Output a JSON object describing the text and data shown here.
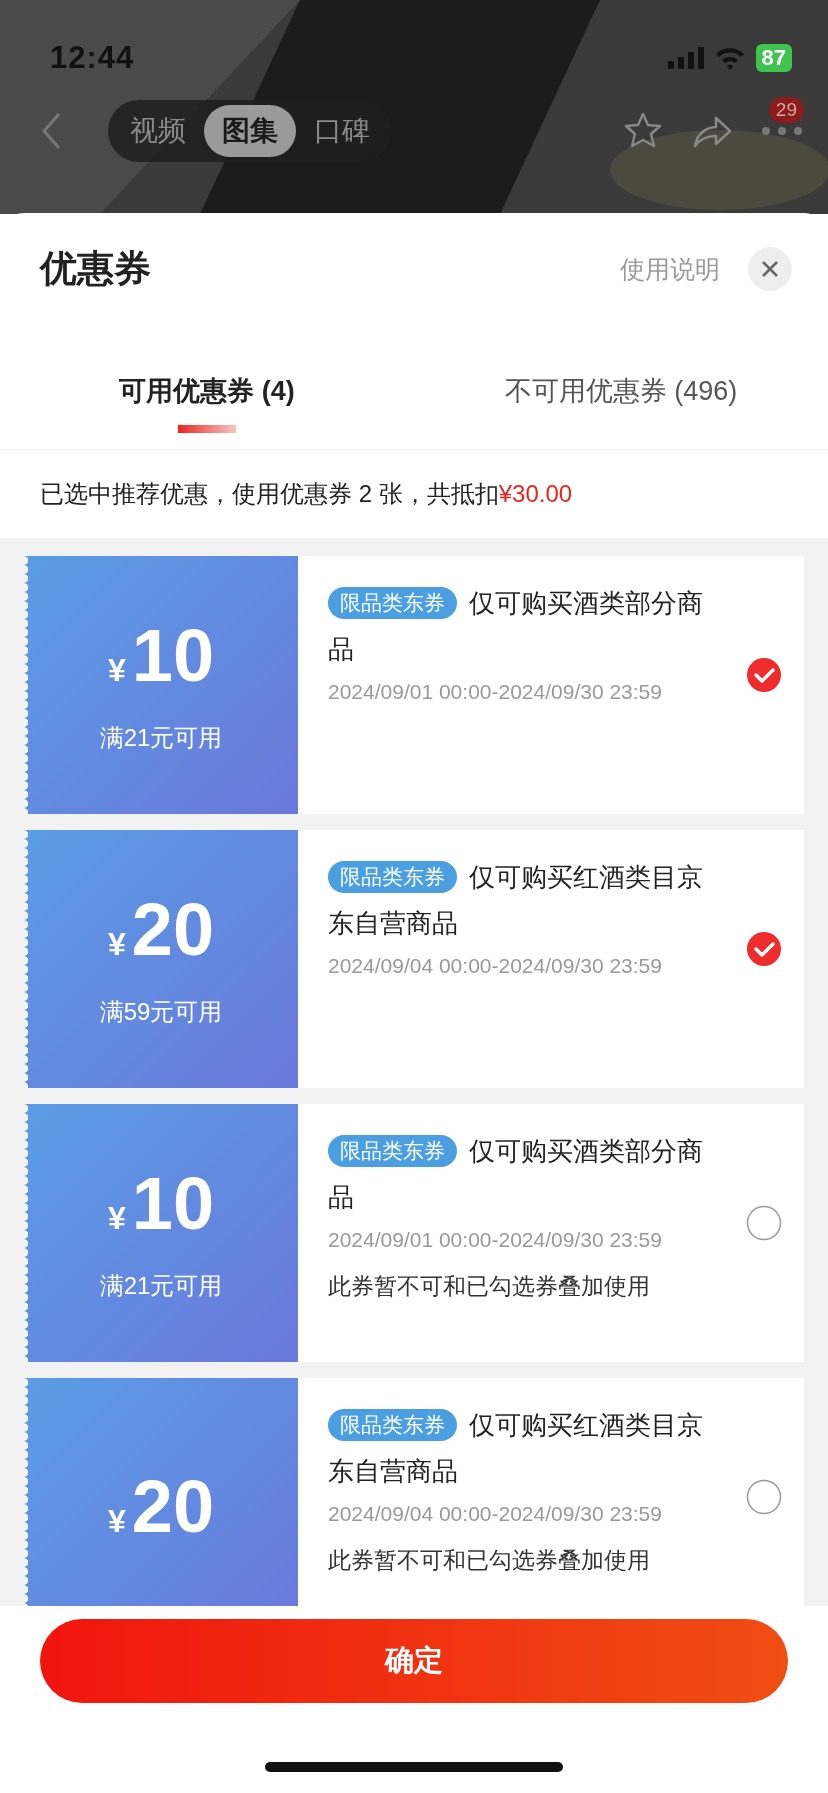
{
  "status_bar": {
    "time": "12:44",
    "battery": "87"
  },
  "nav": {
    "tabs": [
      {
        "label": "视频",
        "selected": false
      },
      {
        "label": "图集",
        "selected": true
      },
      {
        "label": "口碑",
        "selected": false
      }
    ],
    "badge": "29"
  },
  "sheet": {
    "title": "优惠券",
    "help_link": "使用说明"
  },
  "tabs": [
    {
      "label": "可用优惠券 (4)",
      "selected": true
    },
    {
      "label": "不可用优惠券 (496)",
      "selected": false
    }
  ],
  "summary": "已选中推荐优惠，使用优惠券 2 张，共抵扣**¥30.00**",
  "coupons": [
    {
      "currency": "¥",
      "amount": "10",
      "condition": "满21元可用",
      "tag": "限品类东券",
      "title": "仅可购买酒类部分商品",
      "validity": "2024/09/01 00:00-2024/09/30 23:59",
      "selected": true
    },
    {
      "currency": "¥",
      "amount": "20",
      "condition": "满59元可用",
      "tag": "限品类东券",
      "title": "仅可购买红酒类目京东自营商品",
      "validity": "2024/09/04 00:00-2024/09/30 23:59",
      "selected": true
    },
    {
      "currency": "¥",
      "amount": "10",
      "condition": "满21元可用",
      "tag": "限品类东券",
      "title": "仅可购买酒类部分商品",
      "validity": "2024/09/01 00:00-2024/09/30 23:59",
      "note": "此券暂不可和已勾选券叠加使用",
      "selected": false
    },
    {
      "currency": "¥",
      "amount": "20",
      "tag": "限品类东券",
      "title": "仅可购买红酒类目京东自营商品",
      "validity": "2024/09/04 00:00-2024/09/30 23:59",
      "note": "此券暂不可和已勾选券叠加使用",
      "selected": false
    }
  ],
  "confirm_button": "确定"
}
